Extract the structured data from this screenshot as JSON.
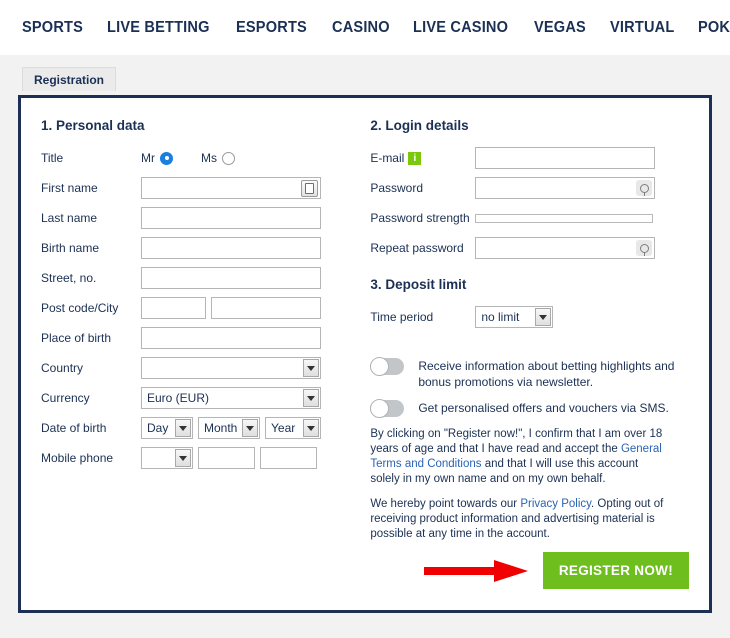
{
  "nav": {
    "items": [
      {
        "label": "SPORTS"
      },
      {
        "label": "LIVE BETTING"
      },
      {
        "label": "ESPORTS"
      },
      {
        "label": "CASINO"
      },
      {
        "label": "LIVE CASINO"
      },
      {
        "label": "VEGAS"
      },
      {
        "label": "VIRTUAL"
      },
      {
        "label": "POKER"
      }
    ]
  },
  "tab": {
    "label": "Registration"
  },
  "personal": {
    "title": "1. Personal data",
    "labels": {
      "title": "Title",
      "first_name": "First name",
      "last_name": "Last name",
      "birth_name": "Birth name",
      "street": "Street, no.",
      "post_city": "Post code/City",
      "place_of_birth": "Place of birth",
      "country": "Country",
      "currency": "Currency",
      "date_of_birth": "Date of birth",
      "mobile_phone": "Mobile phone"
    },
    "title_options": {
      "mr": "Mr",
      "ms": "Ms",
      "selected": "Mr"
    },
    "values": {
      "first_name": "",
      "last_name": "",
      "birth_name": "",
      "street": "",
      "post_code": "",
      "city": "",
      "place_of_birth": "",
      "country": "",
      "currency": "Euro (EUR)",
      "dob_day": "Day",
      "dob_month": "Month",
      "dob_year": "Year",
      "phone_prefix": "",
      "phone_part1": "",
      "phone_part2": ""
    }
  },
  "login": {
    "title": "2. Login details",
    "labels": {
      "email": "E-mail",
      "password": "Password",
      "password_strength": "Password strength",
      "repeat_password": "Repeat password"
    },
    "info_badge": "i",
    "values": {
      "email": "",
      "password": "",
      "repeat_password": ""
    }
  },
  "deposit": {
    "title": "3. Deposit limit",
    "labels": {
      "time_period": "Time period"
    },
    "values": {
      "time_period": "no limit"
    }
  },
  "toggles": [
    {
      "label": "Receive information about betting highlights and bonus promotions via newsletter.",
      "on": false
    },
    {
      "label": "Get personalised offers and vouchers via SMS.",
      "on": false
    }
  ],
  "legal": {
    "p1_a": "By clicking on \"Register now!\", I confirm that I am over 18 years of age and that I have read and accept the ",
    "p1_link": "General Terms and Conditions",
    "p1_b": " and that I will use this account solely in my own name and on my own behalf.",
    "p2_a": "We hereby point towards our ",
    "p2_link": "Privacy Policy",
    "p2_b": ". Opting out of receiving product information and advertising material is possible at any time in the account."
  },
  "submit": {
    "label": "REGISTER NOW!"
  },
  "colors": {
    "navy": "#1b3054",
    "green_button": "#6ebe1e",
    "green_badge": "#7ac70c",
    "radio_blue": "#1b7fe0",
    "arrow_red": "#f00000",
    "page_bg": "#f2f2f2"
  }
}
